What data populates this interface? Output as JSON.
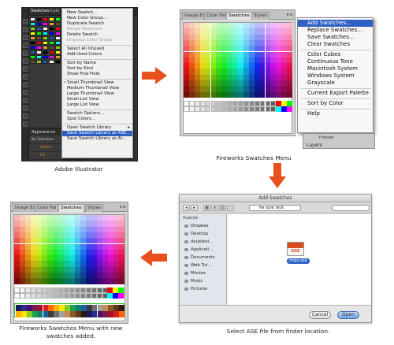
{
  "colors": {
    "arrow": "#e8501e",
    "menu_highlight": "#2c5fbf",
    "new_swatch_outline": "#2ec52e",
    "ase_badge": "#d94d1e"
  },
  "illustrator": {
    "caption": "Adobe Illustrator",
    "tabs": [
      "Swatches",
      "Colo"
    ],
    "appearance_label": "Appearance",
    "appearance_rows": [
      "No Selection",
      "Stroke",
      "Fill",
      "Opacity"
    ],
    "menu": [
      {
        "label": "New Swatch...",
        "disabled": false
      },
      {
        "label": "New Color Group...",
        "disabled": false
      },
      {
        "label": "Duplicate Swatch",
        "disabled": false
      },
      {
        "label": "Merge Swatches",
        "disabled": true
      },
      {
        "label": "Delete Swatch",
        "disabled": false
      },
      {
        "label": "Ungroup Color Group",
        "disabled": true
      },
      {
        "sep": true
      },
      {
        "label": "Select All Unused",
        "disabled": false
      },
      {
        "label": "Add Used Colors",
        "disabled": false
      },
      {
        "sep": true
      },
      {
        "label": "Sort by Name",
        "disabled": false
      },
      {
        "label": "Sort by Kind",
        "disabled": false
      },
      {
        "label": "Show Find Field",
        "disabled": false
      },
      {
        "sep": true
      },
      {
        "label": "Small Thumbnail View",
        "disabled": false,
        "checked": true
      },
      {
        "label": "Medium Thumbnail View",
        "disabled": false
      },
      {
        "label": "Large Thumbnail View",
        "disabled": false
      },
      {
        "label": "Small List View",
        "disabled": false
      },
      {
        "label": "Large List View",
        "disabled": false
      },
      {
        "sep": true
      },
      {
        "label": "Swatch Options...",
        "disabled": false
      },
      {
        "label": "Spot Colors...",
        "disabled": false
      },
      {
        "sep": true
      },
      {
        "label": "Open Swatch Library",
        "disabled": false,
        "submenu": true
      },
      {
        "label": "Save Swatch Library as ASE...",
        "disabled": false,
        "highlighted": true
      },
      {
        "label": "Save Swatch Library as AI...",
        "disabled": false
      }
    ]
  },
  "fireworks_menu": {
    "caption": "Fireworks Swatches Menu",
    "tabs": [
      "Image Edi",
      "Color Pal",
      "Swatches",
      "Styles"
    ],
    "active_tab": "Swatches",
    "dock": {
      "forever": "Forever",
      "layers": "Layers"
    },
    "menu": [
      {
        "label": "Add Swatches...",
        "highlighted": true
      },
      {
        "label": "Replace Swatches..."
      },
      {
        "label": "Save Swatches..."
      },
      {
        "label": "Clear Swatches"
      },
      {
        "sep": true
      },
      {
        "label": "Color Cubes"
      },
      {
        "label": "Continuous Tone"
      },
      {
        "label": "Macintosh System"
      },
      {
        "label": "Windows System"
      },
      {
        "label": "Grayscale"
      },
      {
        "sep": true
      },
      {
        "label": "Current Export Palette"
      },
      {
        "sep": true
      },
      {
        "label": "Sort by Color"
      },
      {
        "sep": true
      },
      {
        "label": "Help"
      }
    ]
  },
  "finder": {
    "title": "Add Swatches",
    "path": "fw size test",
    "places_label": "PLACES",
    "sidebar": [
      "Dropbox",
      "Desktop",
      "doubleol...",
      "Applicati...",
      "Documents",
      "Web Tut...",
      "Movies",
      "Music",
      "Pictures"
    ],
    "file_badge": "ASE",
    "file_name": "mojo.ase",
    "cancel_label": "Cancel",
    "open_label": "Open",
    "caption": "Select ASE file from finder location."
  },
  "fireworks_after": {
    "caption_line1": "Fireworks Swatches Menu with new",
    "caption_line2": "swatches added.",
    "tabs": [
      "Image Edi",
      "Color Pal",
      "Swatches",
      "Styles"
    ],
    "active_tab": "Swatches"
  }
}
